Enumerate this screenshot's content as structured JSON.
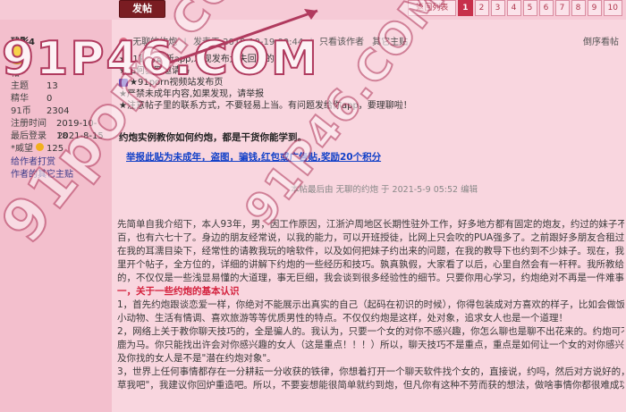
{
  "toolbar": {
    "post_button": "发帖"
  },
  "pager": {
    "back": "返回列表",
    "pages": [
      "1",
      "2",
      "3",
      "4",
      "5",
      "6",
      "7",
      "8",
      "9",
      "10"
    ],
    "current": "1"
  },
  "author": {
    "name": "残影4",
    "stats": [
      {
        "k": "帖",
        "v": ""
      },
      {
        "k": "主题",
        "v": "13"
      },
      {
        "k": "精华",
        "v": "0"
      },
      {
        "k": "91币",
        "v": "2304"
      },
      {
        "k": "注册时间",
        "v": "2019-10-18"
      },
      {
        "k": "最后登录",
        "v": "2021-8-15"
      },
      {
        "k": "*威望",
        "v": "125"
      }
    ],
    "links": [
      "给作者打赏",
      "作者的其它主贴"
    ]
  },
  "post": {
    "status": "无聊的约炮",
    "meta_posted": "发表于 2019-10-19 00:44",
    "only_author": "只看该作者",
    "other_posts": "其它主贴",
    "order": "倒序看帖"
  },
  "notice": [
    "★91官方最新app,发现发布太失回家的路",
    "★如何获取邀请码",
    "★91porn视频站发布页",
    "★严禁未成年内容,如果发现，请举报",
    "★注意帖子里的联系方式，不要轻易上当。有问题发给你app，要理聊啦！"
  ],
  "headline": "约炮实例教你如何约炮，都是干货你能学到。",
  "report": "举报此贴为未成年，盗图，骗钱,红包或广告贴,奖励20个积分",
  "edit_note": "本帖最后由 无聊的约炮 于 2021-5-9 05:52 编辑",
  "body": [
    "先简单自我介绍下，本人93年，男，因工作原因，江浙沪周地区长期性驻外工作，好多地方都有固定的炮友，约过的妹子不及",
    "百，也有六七十了。身边的朋友经常说，以我的能力，可以开班授徒，比网上只会吹的PUA强多了。之前跟好多朋友合租过，",
    "在我的耳濡目染下，经常性的请教我玩的啥软件，以及如何把妹子约出来的问题，在我的教导下也约到不少妹子。现在，我就",
    "里开个帖子，全方位的，详细的讲解下约炮的一些经历和技巧。孰真孰假，大家看了以后，心里自然会有一杆秤。我所教给大",
    "的，不仅仅是一些浅显易懂的大道理，事无巨细，我会谈到很多经验性的细节。只要你用心学习，约炮绝对不再是一件难事儿",
    "一，关于一些约炮的基本认识",
    "1，首先约炮跟谈恋爱一样，你绝对不能展示出真实的自己（起码在初识的时候），你得包装成对方喜欢的样子，比如会做饭、",
    "小动物、生活有情调、喜欢旅游等等优质男性的特点。不仅仅约炮是这样，处对象，追求女人也是一个道理！",
    "2，网络上关于教你聊天技巧的，全是骗人的。我认为，只要一个女的对你不感兴趣，你怎么聊也是聊不出花来的。约炮可不是",
    "鹿为马。你只能找出许会对你感兴趣的女人（这是重点！！！）所以，聊天技巧不是重点，重点是如何让一个女的对你感兴趣",
    "及你找的女人是不是\"潜在约炮对象\"。",
    "3，世界上任何事情都存在一分耕耘一分收获的铁律，你想着打开一个聊天软件找个女的，直接说，约吗，然后对方说好的，\"",
    "草我吧\"，我建议你回炉重造吧。所以，不要妄想能很简单就约到炮，但凡你有这种不劳而获的想法，做啥事情你都很难成功。"
  ],
  "watermarks": [
    "91P46.COM",
    "91porn.com",
    "91P46.COM"
  ]
}
